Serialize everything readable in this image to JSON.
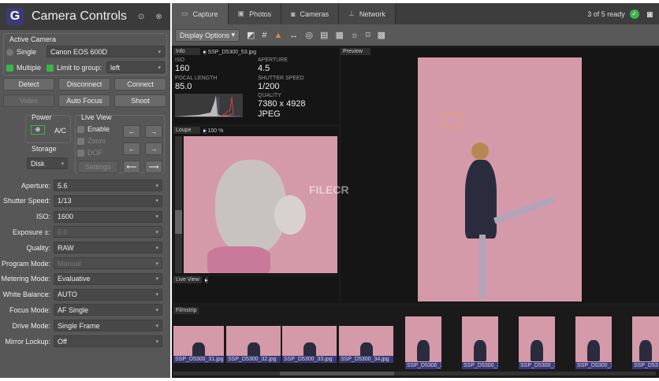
{
  "window": {
    "title": "Camera Controls",
    "logo": "G"
  },
  "active_camera": {
    "title": "Active Camera",
    "single_label": "Single",
    "camera": "Canon EOS 600D",
    "multiple_label": "Multiple",
    "limit_label": "Limit to group:",
    "group": "left"
  },
  "buttons": {
    "detect": "Detect",
    "disconnect": "Disconnect",
    "connect": "Connect",
    "video": "Video",
    "auto_focus": "Auto Focus",
    "shoot": "Shoot"
  },
  "power": {
    "title": "Power",
    "value": "A/C"
  },
  "storage": {
    "title": "Storage",
    "value": "Disk"
  },
  "live_view": {
    "title": "Live View",
    "enable": "Enable",
    "zoom": "Zoom",
    "dof": "DOF",
    "settings": "Settings"
  },
  "settings": [
    {
      "label": "Aperture:",
      "value": "5.6",
      "disabled": false
    },
    {
      "label": "Shutter Speed:",
      "value": "1/13",
      "disabled": false
    },
    {
      "label": "ISO:",
      "value": "1600",
      "disabled": false
    },
    {
      "label": "Exposure ±:",
      "value": "0.0",
      "disabled": true
    },
    {
      "label": "Quality:",
      "value": "RAW",
      "disabled": false
    },
    {
      "label": "Program Mode:",
      "value": "Manual",
      "disabled": true
    },
    {
      "label": "Metering Mode:",
      "value": "Evaluative",
      "disabled": false
    },
    {
      "label": "White Balance:",
      "value": "AUTO",
      "disabled": false
    },
    {
      "label": "Focus Mode:",
      "value": "AF Single",
      "disabled": false
    },
    {
      "label": "Drive Mode:",
      "value": "Single Frame",
      "disabled": false
    },
    {
      "label": "Mirror Lockup:",
      "value": "Off",
      "disabled": false
    }
  ],
  "tabs": [
    {
      "label": "Capture",
      "icon": "monitor-icon"
    },
    {
      "label": "Photos",
      "icon": "photos-icon"
    },
    {
      "label": "Cameras",
      "icon": "camera-icon"
    },
    {
      "label": "Network",
      "icon": "network-icon"
    }
  ],
  "status": "3 of 5 ready",
  "toolbar": {
    "display_options": "Display Options"
  },
  "info": {
    "title": "Info",
    "file": "SSP_D5300_53.jpg",
    "iso_k": "ISO",
    "iso": "160",
    "ap_k": "APERTURE",
    "ap": "4.5",
    "fl_k": "FOCAL LENGTH",
    "fl": "85.0",
    "ss_k": "SHUTTER SPEED",
    "ss": "1/200",
    "q_k": "QUALITY",
    "res": "7380 x 4928",
    "fmt": "JPEG"
  },
  "loupe": {
    "title": "Loupe",
    "zoom": "100 %"
  },
  "liveview_pane": {
    "title": "Live View"
  },
  "preview": {
    "title": "Preview",
    "watermark": "FILECR"
  },
  "filmstrip": {
    "title": "Filmstrip",
    "items": [
      "SSP_D5300_31.jpg",
      "SSP_D5300_32.jpg",
      "SSP_D5300_33.jpg",
      "SSP_D5300_34.jpg",
      "SSP_D5300_3",
      "SSP_D5300_3",
      "SSP_D5300_3",
      "SSP_D5300_3",
      "SSP_D53"
    ]
  },
  "colors": {
    "accent": "#3ab54a",
    "pink": "#d49aaa"
  }
}
